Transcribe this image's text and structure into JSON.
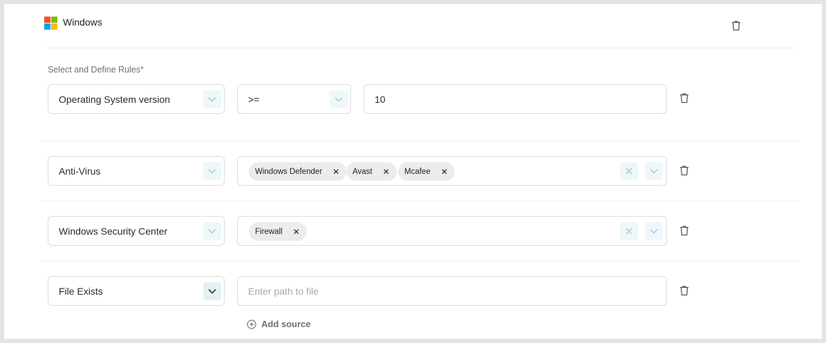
{
  "header": {
    "title": "Windows",
    "logo_colors": [
      "#f25022",
      "#7fba00",
      "#00a4ef",
      "#ffb900"
    ]
  },
  "rules_label": "Select and Define Rules*",
  "rows": [
    {
      "property": "Operating System version",
      "operator": ">=",
      "value": "10"
    },
    {
      "property": "Anti-Virus",
      "tags": [
        "Windows Defender",
        "Avast",
        "Mcafee"
      ]
    },
    {
      "property": "Windows Security Center",
      "tags": [
        "Firewall"
      ]
    },
    {
      "property": "File Exists",
      "path_placeholder": "Enter path to file"
    }
  ],
  "add_source_label": "Add source",
  "colors": {
    "accent_bg": "#eef7f9",
    "chip_bg": "#ececec",
    "border": "#dcdcdc"
  }
}
